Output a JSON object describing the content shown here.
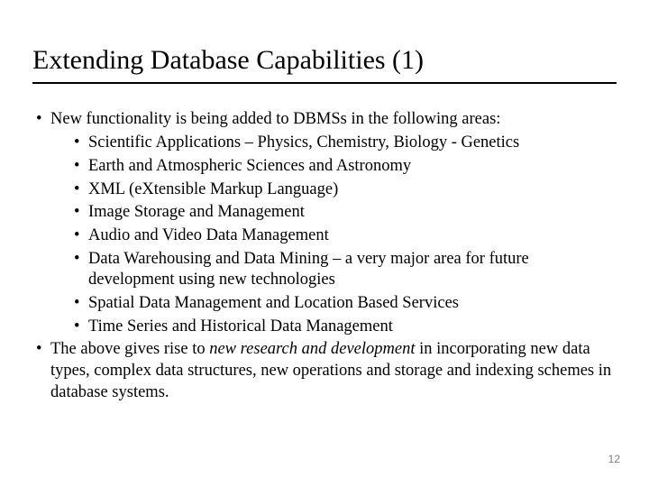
{
  "title": "Extending Database Capabilities (1)",
  "bullets": {
    "intro": "New functionality is being added to DBMSs in the following areas:",
    "sub": [
      "Scientific Applications – Physics, Chemistry, Biology - Genetics",
      "Earth and Atmospheric Sciences and Astronomy",
      "XML (eXtensible Markup Language)",
      "Image Storage and Management",
      "Audio and Video Data Management",
      "Data Warehousing and Data Mining – a very major area for future development using new technologies",
      "Spatial Data Management and Location Based Services",
      "Time Series and Historical Data Management"
    ],
    "closing_pre": "The above gives rise to ",
    "closing_em": "new research and development",
    "closing_post": " in incorporating new data types, complex data structures, new operations and storage and indexing schemes in database systems."
  },
  "page_number": "12"
}
